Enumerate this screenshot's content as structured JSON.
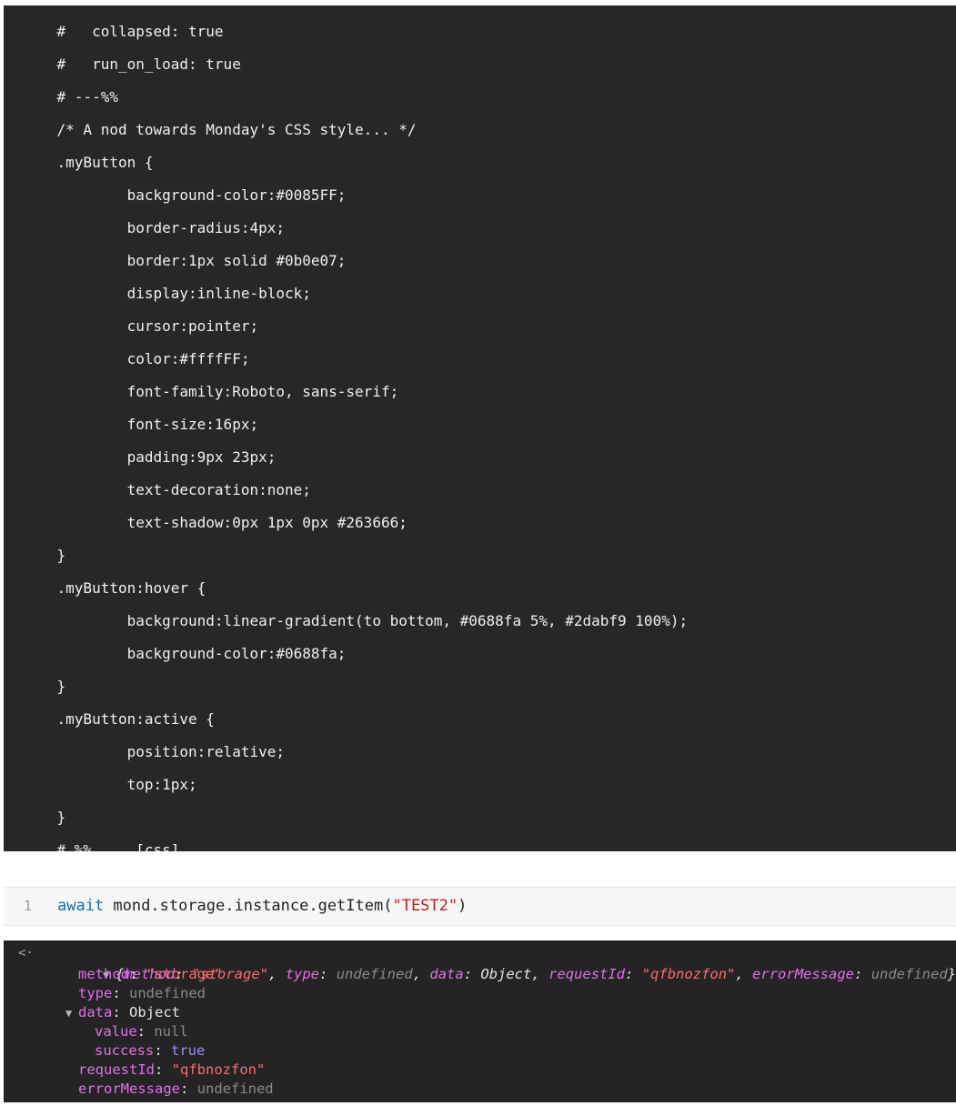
{
  "code_lines": [
    "    #   collapsed: true",
    "    #   run_on_load: true",
    "    # ---%%",
    "    /* A nod towards Monday's CSS style... */",
    "    .myButton {",
    "            background-color:#0085FF;",
    "            border-radius:4px;",
    "            border:1px solid #0b0e07;",
    "            display:inline-block;",
    "            cursor:pointer;",
    "            color:#ffffFF;",
    "            font-family:Roboto, sans-serif;",
    "            font-size:16px;",
    "            padding:9px 23px;",
    "            text-decoration:none;",
    "            text-shadow:0px 1px 0px #263666;",
    "    }",
    "    .myButton:hover {",
    "            background:linear-gradient(to bottom, #0688fa 5%, #2dabf9 100%);",
    "            background-color:#0688fa;",
    "    }",
    "    .myButton:active {",
    "            position:relative;",
    "            top:1px;",
    "    }",
    "    # %%     [css]"
  ],
  "console_input": {
    "line_number": "1",
    "keyword": "await",
    "expression": " mond.storage.instance.getItem(",
    "arg": "\"TEST2\"",
    "close": ")"
  },
  "console_output": {
    "return_arrow": "<·",
    "summary": {
      "k1": "method",
      "v1": "\"storage\"",
      "k2": "type",
      "v2": "undefined",
      "k3": "data",
      "v3": "Object",
      "k4": "requestId",
      "v4": "\"qfbnozfon\"",
      "k5": "errorMessage",
      "v5": "undefined"
    },
    "props": {
      "method_key": "method",
      "method_val": "\"storage\"",
      "type_key": "type",
      "type_val": "undefined",
      "data_key": "data",
      "data_val": "Object",
      "value_key": "value",
      "value_val": "null",
      "success_key": "success",
      "success_val": "true",
      "requestId_key": "requestId",
      "requestId_val": "\"qfbnozfon\"",
      "errorMessage_key": "errorMessage",
      "errorMessage_val": "undefined"
    }
  },
  "colors": {
    "code_bg": "#272727",
    "console_bg": "#242424",
    "keyword_blue": "#0b6fb3",
    "string_red": "#c41a16",
    "key_magenta": "#e36eec"
  }
}
